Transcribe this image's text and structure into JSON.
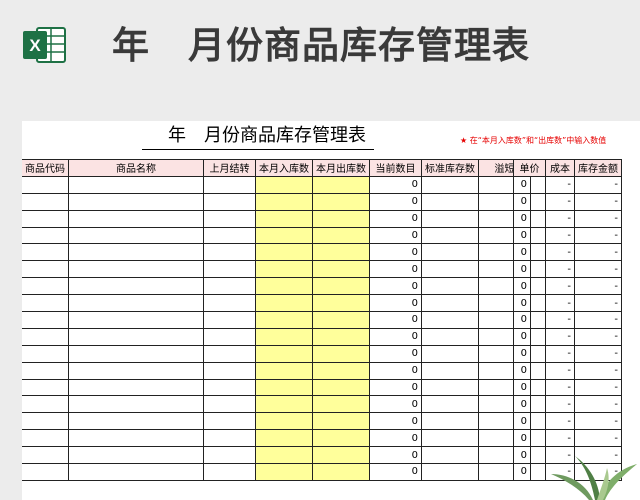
{
  "banner": {
    "title": "年　月份商品库存管理表",
    "logo_letter": "X",
    "logo_color": "#1e7145"
  },
  "sheet": {
    "title": "　年　月份商品库存管理表",
    "note": "★ 在“本月入库数”和“出库数”中输入数值"
  },
  "left_table": {
    "headers": [
      "商品代码",
      "商品名称",
      "上月结转",
      "本月入库数",
      "本月出库数",
      "当前数目",
      "标准库存数",
      "溢短"
    ],
    "current_count": [
      "0",
      "0",
      "0",
      "0",
      "0",
      "0",
      "0",
      "0",
      "0",
      "0",
      "0",
      "0",
      "0",
      "0",
      "0",
      "0",
      "0",
      "0"
    ],
    "shortage": [
      "0",
      "0",
      "0",
      "0",
      "0",
      "0",
      "0",
      "0",
      "0",
      "0",
      "0",
      "0",
      "0",
      "0",
      "0",
      "0",
      "0",
      "0"
    ]
  },
  "right_table": {
    "headers": [
      "单价",
      "成本",
      "库存金额"
    ],
    "cost": [
      "-",
      "-",
      "-",
      "-",
      "-",
      "-",
      "-",
      "-",
      "-",
      "-",
      "-",
      "-",
      "-",
      "-",
      "-",
      "-",
      "-",
      "-"
    ],
    "amount": [
      "-",
      "-",
      "-",
      "-",
      "-",
      "-",
      "-",
      "-",
      "-",
      "-",
      "-",
      "-",
      "-",
      "-",
      "-",
      "-",
      "-",
      "-"
    ]
  },
  "colors": {
    "header_bg": "#fbe3e3",
    "input_col_bg": "#ffff9b",
    "note_color": "#e60000"
  }
}
